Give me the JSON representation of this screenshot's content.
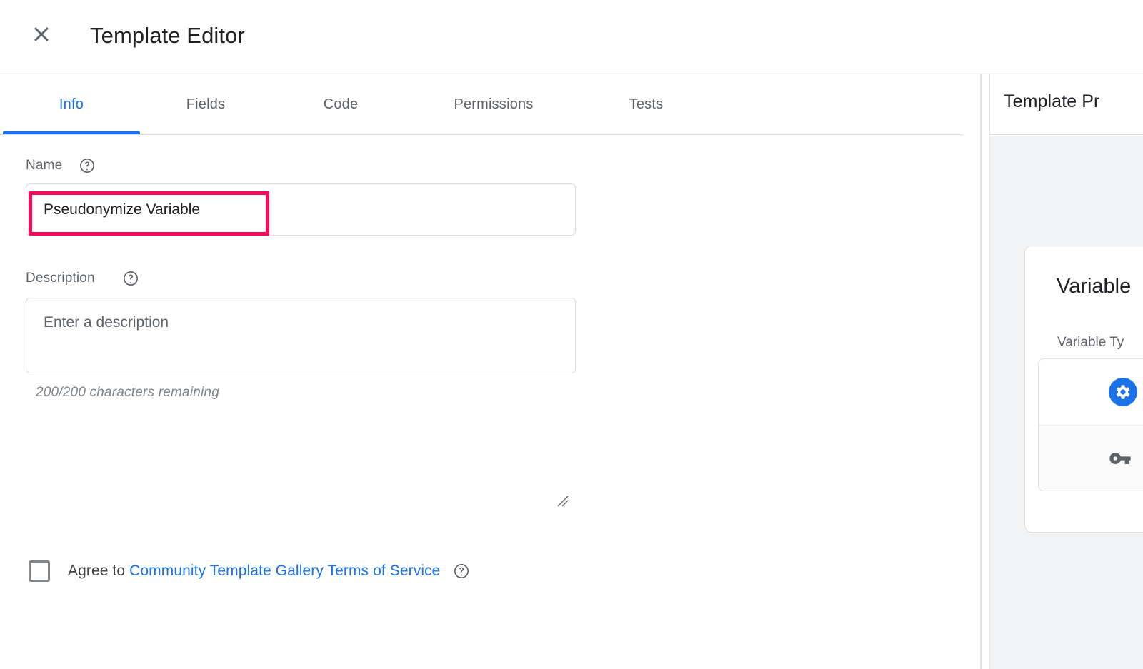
{
  "window": {
    "title": "Template Editor",
    "close_icon": "close-icon"
  },
  "tabs": {
    "items": [
      {
        "label": "Info",
        "active": true
      },
      {
        "label": "Fields",
        "active": false
      },
      {
        "label": "Code",
        "active": false
      },
      {
        "label": "Permissions",
        "active": false
      },
      {
        "label": "Tests",
        "active": false
      }
    ]
  },
  "info_form": {
    "name": {
      "label": "Name",
      "value": "Pseudonymize Variable",
      "help_icon": "help-circle-icon",
      "highlighted": true,
      "highlight_color": "#f50a5c"
    },
    "description": {
      "label": "Description",
      "value": "",
      "placeholder": "Enter a description",
      "help_icon": "help-circle-icon",
      "char_count": "200/200 characters remaining"
    },
    "agree": {
      "checked": false,
      "prefix": "Agree to ",
      "link_text": "Community Template Gallery Terms of Service",
      "help_icon": "help-circle-icon",
      "link_color": "#1a73e8"
    }
  },
  "preview": {
    "header_title": "Template Pr",
    "card": {
      "title": "Variable",
      "subtitle": "Variable Ty",
      "options": [
        {
          "icon": "gear-icon",
          "icon_color": "#1a73e8"
        },
        {
          "icon": "key-icon",
          "icon_color": "#5f6368"
        }
      ]
    }
  }
}
